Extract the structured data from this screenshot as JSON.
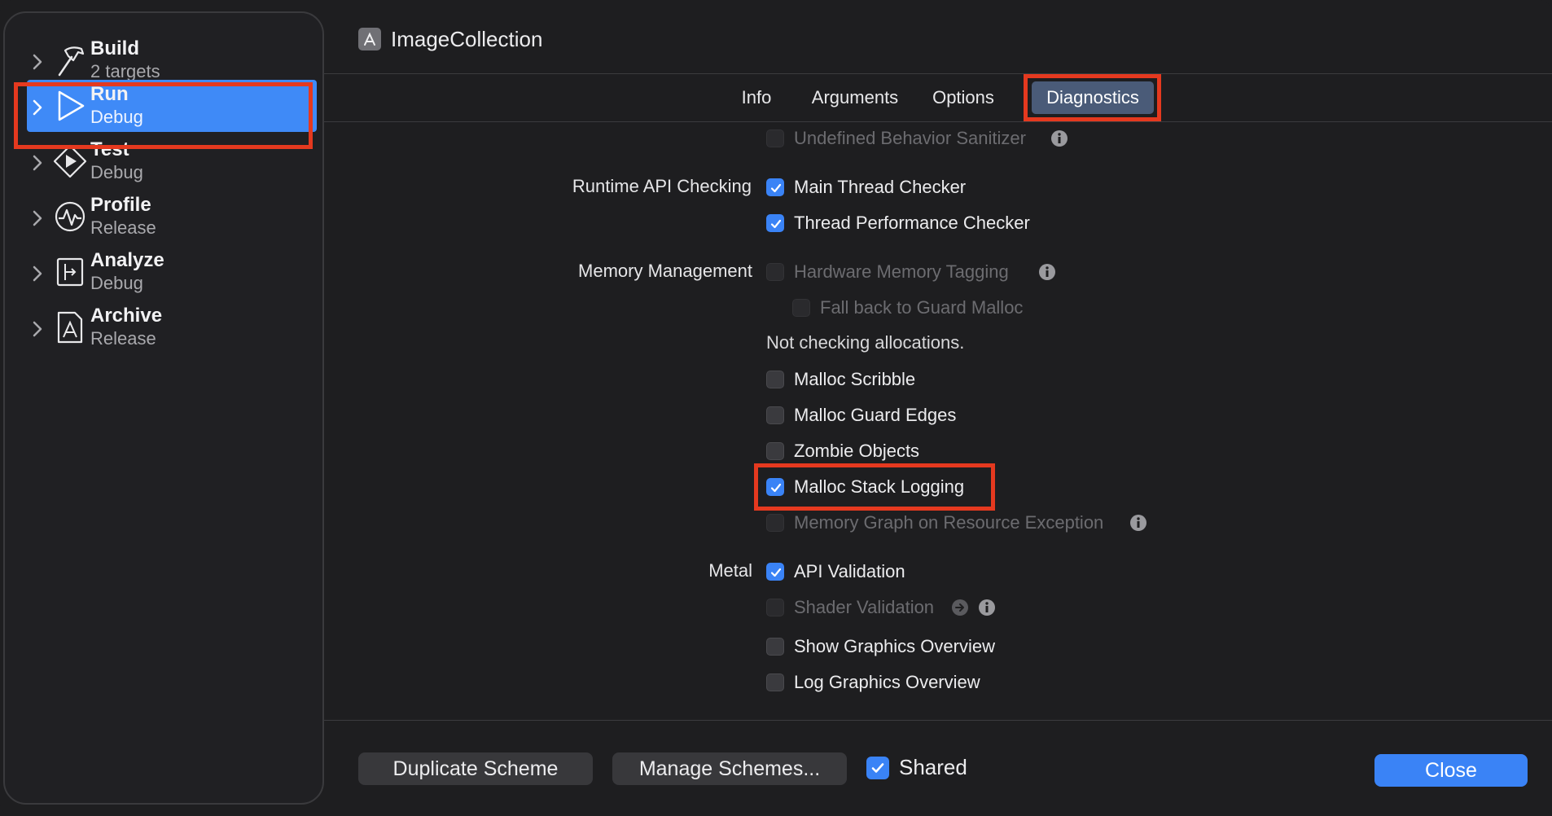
{
  "window": {
    "app_title": "ImageCollection",
    "app_icon": "app-store-icon"
  },
  "sidebar": {
    "items": [
      {
        "title": "Build",
        "subtitle": "2 targets",
        "icon": "hammer-icon"
      },
      {
        "title": "Run",
        "subtitle": "Debug",
        "icon": "play-icon",
        "selected": true
      },
      {
        "title": "Test",
        "subtitle": "Debug",
        "icon": "diamond-play-icon"
      },
      {
        "title": "Profile",
        "subtitle": "Release",
        "icon": "waveform-icon"
      },
      {
        "title": "Analyze",
        "subtitle": "Debug",
        "icon": "analyze-icon"
      },
      {
        "title": "Archive",
        "subtitle": "Release",
        "icon": "archive-icon"
      }
    ]
  },
  "tabs": [
    {
      "label": "Info"
    },
    {
      "label": "Arguments"
    },
    {
      "label": "Options"
    },
    {
      "label": "Diagnostics",
      "active": true
    }
  ],
  "sections": {
    "runtime_api_label": "Runtime API Checking",
    "memory_label": "Memory Management",
    "metal_label": "Metal"
  },
  "options": {
    "undefined_behavior": {
      "label": "Undefined Behavior Sanitizer",
      "checked": false,
      "disabled": true
    },
    "main_thread": {
      "label": "Main Thread Checker",
      "checked": true
    },
    "thread_perf": {
      "label": "Thread Performance Checker",
      "checked": true
    },
    "hw_memory_tagging": {
      "label": "Hardware Memory Tagging",
      "checked": false,
      "disabled": true
    },
    "fallback_guard_malloc": {
      "label": "Fall back to Guard Malloc",
      "checked": false,
      "disabled": true
    },
    "not_checking_note": "Not checking allocations.",
    "malloc_scribble": {
      "label": "Malloc Scribble",
      "checked": false
    },
    "malloc_guard_edges": {
      "label": "Malloc Guard Edges",
      "checked": false
    },
    "zombie_objects": {
      "label": "Zombie Objects",
      "checked": false
    },
    "malloc_stack_logging": {
      "label": "Malloc Stack Logging",
      "checked": true
    },
    "memory_graph": {
      "label": "Memory Graph on Resource Exception",
      "checked": false,
      "disabled": true
    },
    "api_validation": {
      "label": "API Validation",
      "checked": true
    },
    "shader_validation": {
      "label": "Shader Validation",
      "checked": false,
      "disabled": true
    },
    "show_graphics_overview": {
      "label": "Show Graphics Overview",
      "checked": false
    },
    "log_graphics_overview": {
      "label": "Log Graphics Overview",
      "checked": false
    }
  },
  "footer": {
    "duplicate_label": "Duplicate Scheme",
    "manage_label": "Manage Schemes...",
    "shared_label": "Shared",
    "shared_checked": true,
    "close_label": "Close"
  },
  "colors": {
    "accent": "#3a83f6",
    "selection": "#3f8af7",
    "highlight": "#e5391f",
    "active_tab": "#4a5b78"
  }
}
